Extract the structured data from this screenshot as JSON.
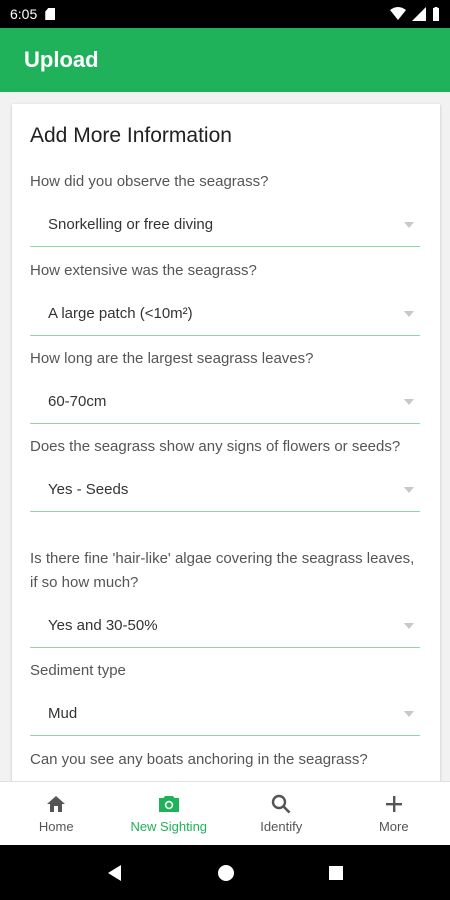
{
  "status_bar": {
    "time": "6:05"
  },
  "app_bar": {
    "title": "Upload"
  },
  "form": {
    "heading": "Add More Information",
    "questions": [
      {
        "label": "How did you observe the seagrass?",
        "value": "Snorkelling or free diving"
      },
      {
        "label": "How extensive was the seagrass?",
        "value": "A large patch (<10m²)"
      },
      {
        "label": "How long are the largest seagrass leaves?",
        "value": "60-70cm"
      },
      {
        "label": "Does the seagrass show any signs of flowers or seeds?",
        "value": "Yes - Seeds"
      },
      {
        "label": "Is there fine 'hair-like' algae covering the seagrass leaves, if so how much?",
        "value": "Yes and 30-50%"
      },
      {
        "label": "Sediment type",
        "value": "Mud"
      },
      {
        "label": "Can you see any boats anchoring in the seagrass?",
        "value": ""
      }
    ]
  },
  "bottom_nav": {
    "items": [
      {
        "label": "Home",
        "icon": "home-icon"
      },
      {
        "label": "New Sighting",
        "icon": "camera-icon"
      },
      {
        "label": "Identify",
        "icon": "search-icon"
      },
      {
        "label": "More",
        "icon": "plus-icon"
      }
    ],
    "active_color": "#1fb25a"
  },
  "colors": {
    "brand": "#1fb25a",
    "underline": "#8ed6a8"
  }
}
